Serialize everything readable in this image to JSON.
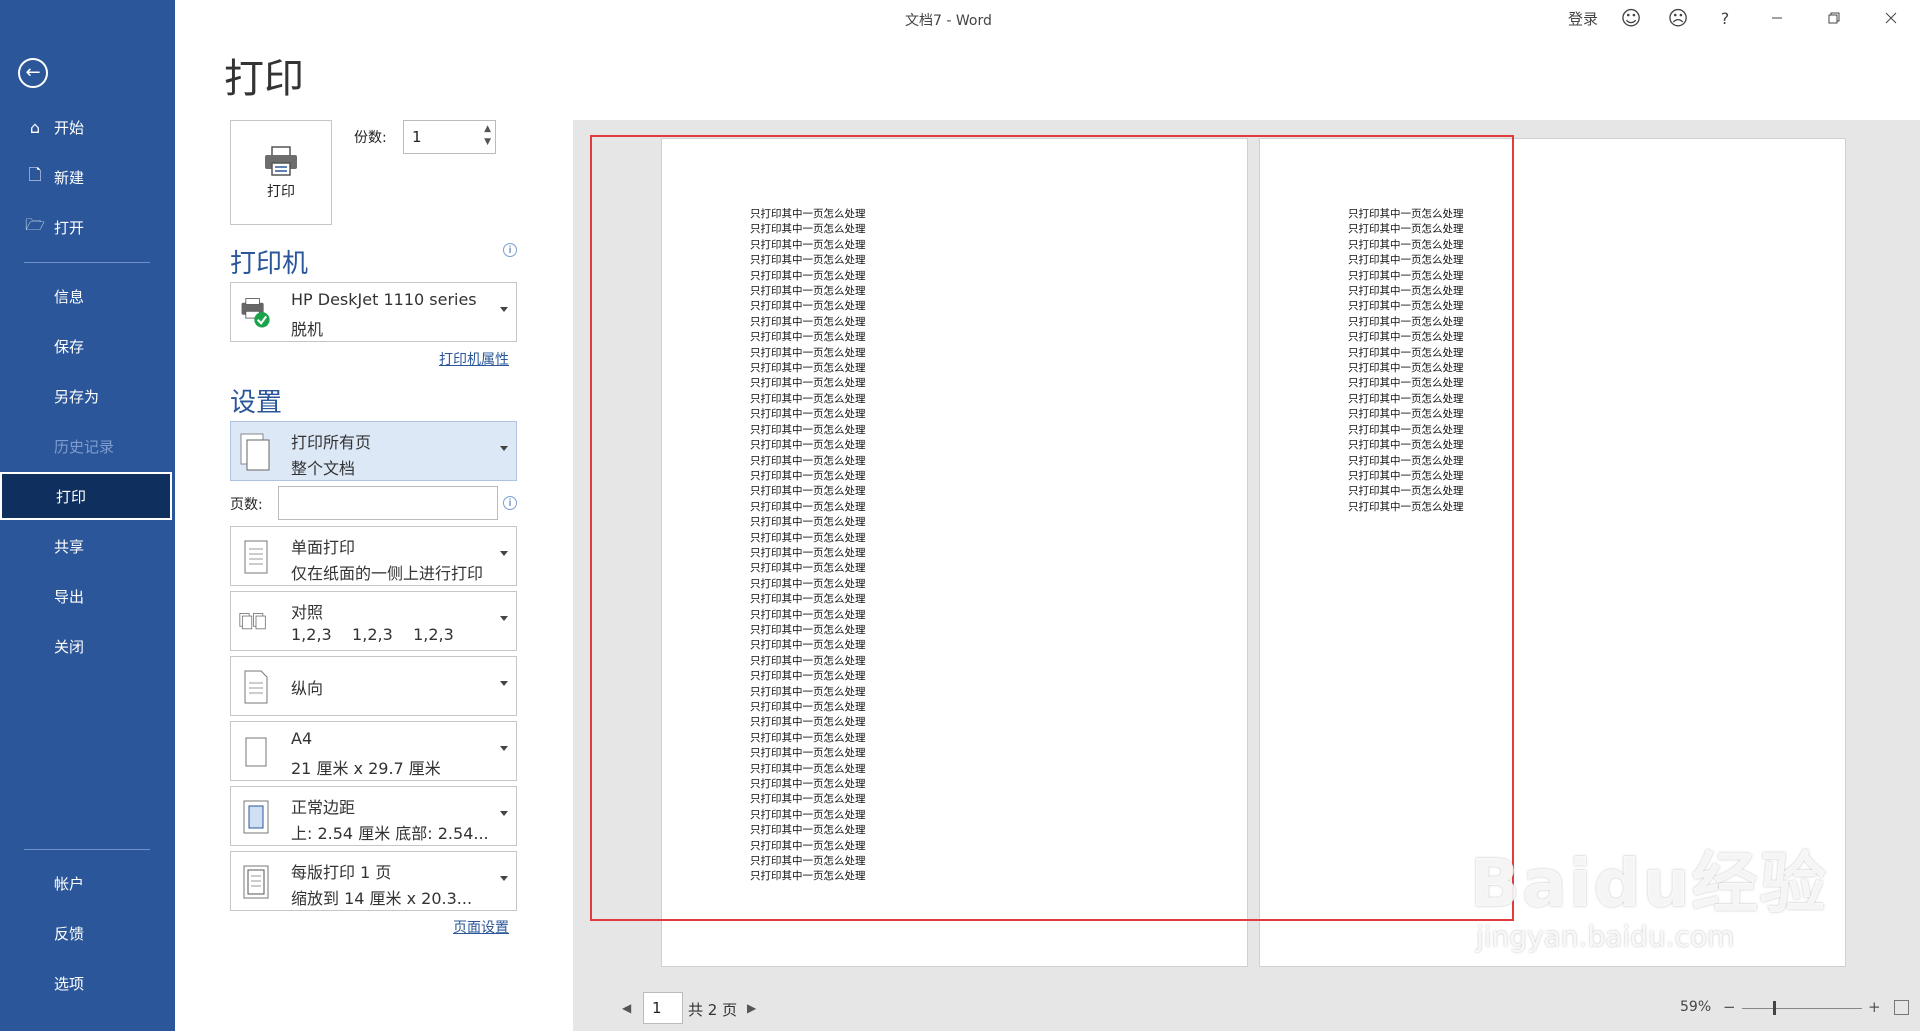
{
  "window": {
    "title": "文档7  -  Word",
    "signin": "登录",
    "help": "?",
    "icons": [
      "smile-icon",
      "frown-icon",
      "minimize-icon",
      "restore-icon",
      "close-icon"
    ]
  },
  "sidebar": {
    "back_icon": "←",
    "items": [
      {
        "label": "开始",
        "icon": "⌂"
      },
      {
        "label": "新建",
        "icon": "🗋"
      },
      {
        "label": "打开",
        "icon": "🗁"
      },
      {
        "label": "信息"
      },
      {
        "label": "保存"
      },
      {
        "label": "另存为"
      },
      {
        "label": "历史记录",
        "state": "disabled"
      },
      {
        "label": "打印",
        "state": "active"
      },
      {
        "label": "共享"
      },
      {
        "label": "导出"
      },
      {
        "label": "关闭"
      },
      {
        "label": "帐户"
      },
      {
        "label": "反馈"
      },
      {
        "label": "选项"
      }
    ],
    "colors": {
      "background": "#2b579a",
      "active": "#0f2f5f"
    }
  },
  "print": {
    "heading": "打印",
    "print_button": "打印",
    "copies_label": "份数:",
    "copies_value": "1"
  },
  "printer": {
    "section_title": "打印机",
    "name": "HP DeskJet 1110 series",
    "status": "脱机",
    "properties_link": "打印机属性"
  },
  "settings": {
    "section_title": "设置",
    "range": {
      "line1": "打印所有页",
      "line2": "整个文档"
    },
    "pages_label": "页数:",
    "pages_value": "",
    "sides": {
      "line1": "单面打印",
      "line2": "仅在纸面的一侧上进行打印"
    },
    "collate": {
      "line1": "对照",
      "line2": "1,2,3    1,2,3    1,2,3"
    },
    "orientation": {
      "line1": "纵向"
    },
    "paper": {
      "line1": "A4",
      "line2": "21 厘米 x 29.7 厘米"
    },
    "margins": {
      "line1": "正常边距",
      "line2": "上: 2.54 厘米 底部: 2.54..."
    },
    "per_sheet": {
      "line1": "每版打印 1 页",
      "line2": "缩放到 14 厘米 x 20.3..."
    },
    "page_setup_link": "页面设置"
  },
  "preview": {
    "line_text": "只打印其中一页怎么处理",
    "page1_line_count": 44,
    "page2_line_count": 20
  },
  "navigation": {
    "current_page": "1",
    "total_pages": "共 2 页",
    "zoom": "59%",
    "zoom_minus": "−",
    "zoom_plus": "+"
  },
  "watermark": {
    "brand": "Baidu经验",
    "url": "jingyan.baidu.com"
  },
  "accent_colors": {
    "highlight": "#e03c3c",
    "word_blue": "#2b579a"
  }
}
